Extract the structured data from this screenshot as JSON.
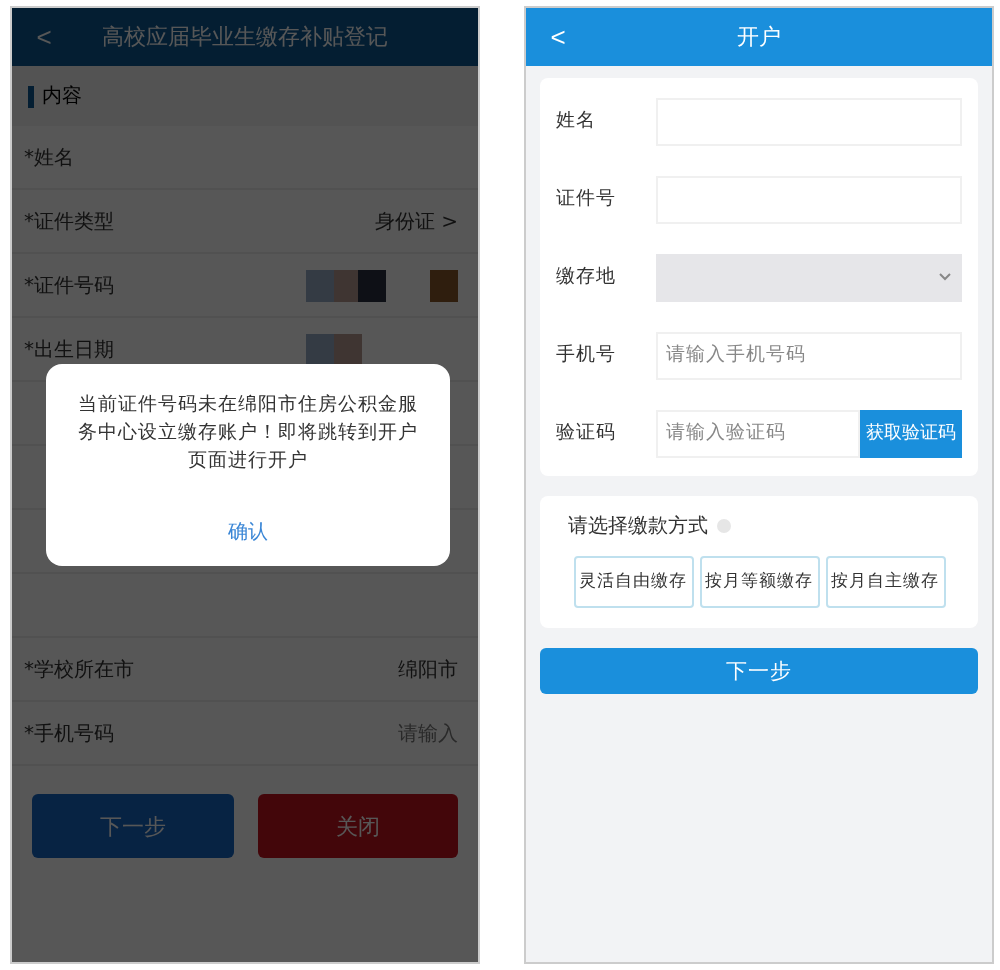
{
  "left_screen": {
    "title": "高校应届毕业生缴存补贴登记",
    "back": "<",
    "section": "内容",
    "rows": [
      {
        "label": "*姓名",
        "kind": "text"
      },
      {
        "label": "*证件类型",
        "value": "身份证 >",
        "kind": "text"
      },
      {
        "label": "*证件号码",
        "kind": "masked"
      },
      {
        "label": "*出生日期",
        "kind": "masked"
      },
      {
        "kind": "text"
      },
      {
        "kind": "text"
      },
      {
        "kind": "text"
      },
      {
        "kind": "text"
      },
      {
        "label": "*学校所在市",
        "value": "绵阳市",
        "kind": "text"
      },
      {
        "label": "*手机号码",
        "value": "请输入",
        "kind": "placeholder"
      }
    ],
    "buttons": [
      {
        "label": "下一步",
        "kind": "primary"
      },
      {
        "label": "关闭",
        "kind": "danger"
      }
    ],
    "dialog": {
      "message": "当前证件号码未在绵阳市住房公积金服务中心设立缴存账户！即将跳转到开户页面进行开户",
      "button": "确认"
    }
  },
  "right_screen": {
    "title": "开户",
    "back": "<",
    "fields": [
      {
        "label": "姓名",
        "kind": "input"
      },
      {
        "label": "证件号",
        "kind": "input"
      },
      {
        "label": "缴存地",
        "kind": "select"
      },
      {
        "label": "手机号",
        "kind": "input",
        "placeholder": "请输入手机号码"
      },
      {
        "label": "验证码",
        "kind": "code",
        "placeholder": "请输入验证码",
        "button": "获取验证码"
      }
    ],
    "payment_title": "请选择缴款方式",
    "payment_options": [
      {
        "label": "灵活自由缴存",
        "selected": false
      },
      {
        "label": "按月等额缴存",
        "selected": false
      },
      {
        "label": "按月自主缴存",
        "selected": false
      }
    ],
    "next_button": "下一步"
  }
}
